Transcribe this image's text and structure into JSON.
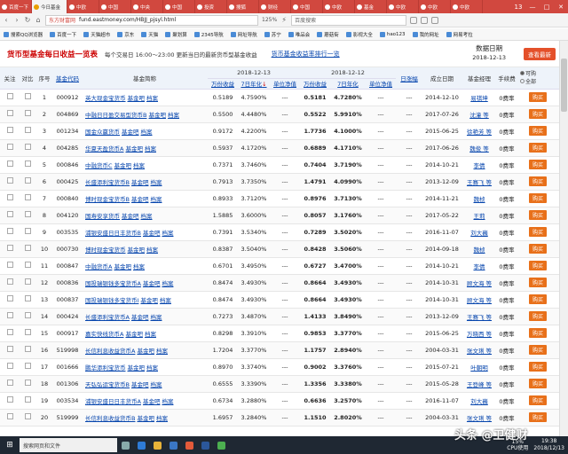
{
  "tabs": [
    {
      "label": "百度一下",
      "active": false
    },
    {
      "label": "今日基金",
      "active": true
    },
    {
      "label": "中欧",
      "active": false
    },
    {
      "label": "中国",
      "active": false
    },
    {
      "label": "中央",
      "active": false
    },
    {
      "label": "中国",
      "active": false
    },
    {
      "label": "投资",
      "active": false
    },
    {
      "label": "搜狐",
      "active": false
    },
    {
      "label": "财经",
      "active": false
    },
    {
      "label": "中国",
      "active": false
    },
    {
      "label": "中欧",
      "active": false
    },
    {
      "label": "基金",
      "active": false
    },
    {
      "label": "中欧",
      "active": false
    },
    {
      "label": "中欧",
      "active": false
    },
    {
      "label": "中欧",
      "active": false
    }
  ],
  "window_controls": {
    "count": "13",
    "min": "—",
    "max": "□",
    "close": "✕"
  },
  "address": {
    "site": "东方财富网",
    "url": "fund.eastmoney.com/HBJJ_pjsyl.html",
    "zoom": "125%",
    "search": "百度搜索"
  },
  "bookmarks": [
    "搜索QQ浏览器",
    "百度一下",
    "天猫超市",
    "京东",
    "天猫",
    "聚划算",
    "2345导航",
    "网址导航",
    "苏宁",
    "唯品会",
    "蘑菇街",
    "影视大全",
    "hao123",
    "我的网址",
    "网易考拉"
  ],
  "header": {
    "title": "货币型基金每日收益一览表",
    "trading_time": "每个交易日 16:00～23:00 更新当日的最新货币型基金收益",
    "link": "货币基金收益率排行一览",
    "date_label": "数据日期",
    "date": "2018-12-13",
    "refresh": "查看最新"
  },
  "columns": {
    "follow": "关注",
    "compare": "对比",
    "seq": "序号",
    "code": "基金代码",
    "name": "基金简称",
    "date1": "2018-12-13",
    "date2": "2018-12-12",
    "wan": "万份收益",
    "nian": "7日年化",
    "nav": "单位净值",
    "daily": "日涨幅",
    "estab": "成立日期",
    "manager": "基金经理",
    "fee": "手续费",
    "opt_buy": "可购",
    "opt_all": "全部"
  },
  "labels": {
    "ba": "基金吧",
    "dang": "档案",
    "buy": "购买"
  },
  "rows": [
    {
      "seq": "1",
      "code": "000912",
      "name": "英大现金宝货币",
      "w1": "0.5189",
      "n1": "4.7590%",
      "u1": "---",
      "w2": "0.5181",
      "n2": "4.7280%",
      "u2": "---",
      "d": "---",
      "estab": "2014-12-10",
      "mgr": "易祺坤",
      "fee": "0费率"
    },
    {
      "seq": "2",
      "code": "004869",
      "name": "中融日日盈交易型货币B",
      "w1": "0.5500",
      "n1": "4.4480%",
      "u1": "---",
      "w2": "0.5522",
      "n2": "5.9910%",
      "u2": "---",
      "d": "---",
      "estab": "2017-07-26",
      "mgr": "沈潼 等",
      "fee": "0费率"
    },
    {
      "seq": "3",
      "code": "001234",
      "name": "国金众赢货币",
      "w1": "0.9172",
      "n1": "4.2200%",
      "u1": "---",
      "w2": "1.7736",
      "n2": "4.1000%",
      "u2": "---",
      "d": "---",
      "estab": "2015-06-25",
      "mgr": "徐艳芳 等",
      "fee": "0费率"
    },
    {
      "seq": "4",
      "code": "004285",
      "name": "华夏天盈货币A",
      "w1": "0.5937",
      "n1": "4.1720%",
      "u1": "---",
      "w2": "0.6889",
      "n2": "4.1710%",
      "u2": "---",
      "d": "---",
      "estab": "2017-06-26",
      "mgr": "魏俊 等",
      "fee": "0费率"
    },
    {
      "seq": "5",
      "code": "000846",
      "name": "中融货币C",
      "w1": "0.7371",
      "n1": "3.7460%",
      "u1": "---",
      "w2": "0.7404",
      "n2": "3.7190%",
      "u2": "---",
      "d": "---",
      "estab": "2014-10-21",
      "mgr": "李倩",
      "fee": "0费率"
    },
    {
      "seq": "6",
      "code": "000425",
      "name": "长盛添利宝货币B",
      "w1": "0.7913",
      "n1": "3.7350%",
      "u1": "---",
      "w2": "1.4791",
      "n2": "4.0990%",
      "u2": "---",
      "d": "---",
      "estab": "2013-12-09",
      "mgr": "王赛飞 等",
      "fee": "0费率"
    },
    {
      "seq": "7",
      "code": "000840",
      "name": "博时现金宝货币B",
      "w1": "0.8933",
      "n1": "3.7120%",
      "u1": "---",
      "w2": "0.8976",
      "n2": "3.7130%",
      "u2": "---",
      "d": "---",
      "estab": "2014-11-21",
      "mgr": "魏桢",
      "fee": "0费率"
    },
    {
      "seq": "8",
      "code": "004120",
      "name": "国寿安享货币",
      "w1": "1.5885",
      "n1": "3.6000%",
      "u1": "---",
      "w2": "0.8057",
      "n2": "3.1760%",
      "u2": "---",
      "d": "---",
      "estab": "2017-05-22",
      "mgr": "王莉",
      "fee": "0费率"
    },
    {
      "seq": "9",
      "code": "003535",
      "name": "浦银安盛日日丰货币B",
      "w1": "0.7391",
      "n1": "3.5340%",
      "u1": "---",
      "w2": "0.7289",
      "n2": "3.5020%",
      "u2": "---",
      "d": "---",
      "estab": "2016-11-07",
      "mgr": "刘大巍",
      "fee": "0费率"
    },
    {
      "seq": "10",
      "code": "000730",
      "name": "博时现金宝货币",
      "w1": "0.8387",
      "n1": "3.5040%",
      "u1": "---",
      "w2": "0.8428",
      "n2": "3.5060%",
      "u2": "---",
      "d": "---",
      "estab": "2014-09-18",
      "mgr": "魏桢",
      "fee": "0费率"
    },
    {
      "seq": "11",
      "code": "000847",
      "name": "中融货币A",
      "w1": "0.6701",
      "n1": "3.4950%",
      "u1": "---",
      "w2": "0.6727",
      "n2": "3.4700%",
      "u2": "---",
      "d": "---",
      "estab": "2014-10-21",
      "mgr": "李倩",
      "fee": "0费率"
    },
    {
      "seq": "12",
      "code": "000836",
      "name": "国投瑞银钱多宝货币A",
      "w1": "0.8474",
      "n1": "3.4930%",
      "u1": "---",
      "w2": "0.8664",
      "n2": "3.4930%",
      "u2": "---",
      "d": "---",
      "estab": "2014-10-31",
      "mgr": "顾文海 等",
      "fee": "0费率"
    },
    {
      "seq": "13",
      "code": "000837",
      "name": "国投瑞银钱多宝货币I",
      "w1": "0.8474",
      "n1": "3.4930%",
      "u1": "---",
      "w2": "0.8664",
      "n2": "3.4930%",
      "u2": "---",
      "d": "---",
      "estab": "2014-10-31",
      "mgr": "顾文海 等",
      "fee": "0费率"
    },
    {
      "seq": "14",
      "code": "000424",
      "name": "长盛添利宝货币A",
      "w1": "0.7273",
      "n1": "3.4870%",
      "u1": "---",
      "w2": "1.4133",
      "n2": "3.8490%",
      "u2": "---",
      "d": "---",
      "estab": "2013-12-09",
      "mgr": "王赛飞 等",
      "fee": "0费率"
    },
    {
      "seq": "15",
      "code": "000917",
      "name": "嘉实快线货币A",
      "w1": "0.8298",
      "n1": "3.3910%",
      "u1": "---",
      "w2": "0.9853",
      "n2": "3.3770%",
      "u2": "---",
      "d": "---",
      "estab": "2015-06-25",
      "mgr": "万晓西 等",
      "fee": "0费率"
    },
    {
      "seq": "16",
      "code": "519998",
      "name": "长信利息收益货币A",
      "w1": "1.7204",
      "n1": "3.3770%",
      "u1": "---",
      "w2": "1.1757",
      "n2": "2.8940%",
      "u2": "---",
      "d": "---",
      "estab": "2004-03-31",
      "mgr": "张文琍 等",
      "fee": "0费率"
    },
    {
      "seq": "17",
      "code": "001666",
      "name": "鹏华添利宝货币",
      "w1": "0.8970",
      "n1": "3.3740%",
      "u1": "---",
      "w2": "0.9002",
      "n2": "3.3760%",
      "u2": "---",
      "d": "---",
      "estab": "2015-07-21",
      "mgr": "叶朝明",
      "fee": "0费率"
    },
    {
      "seq": "18",
      "code": "001306",
      "name": "天弘弘运宝货币B",
      "w1": "0.6555",
      "n1": "3.3390%",
      "u1": "---",
      "w2": "1.3356",
      "n2": "3.3380%",
      "u2": "---",
      "d": "---",
      "estab": "2015-05-28",
      "mgr": "王登峰 等",
      "fee": "0费率"
    },
    {
      "seq": "19",
      "code": "003534",
      "name": "浦银安盛日日丰货币A",
      "w1": "0.6734",
      "n1": "3.2880%",
      "u1": "---",
      "w2": "0.6636",
      "n2": "3.2570%",
      "u2": "---",
      "d": "---",
      "estab": "2016-11-07",
      "mgr": "刘大巍",
      "fee": "0费率"
    },
    {
      "seq": "20",
      "code": "519999",
      "name": "长信利息收益货币B",
      "w1": "1.6957",
      "n1": "3.2840%",
      "u1": "---",
      "w2": "1.1510",
      "n2": "2.8020%",
      "u2": "---",
      "d": "---",
      "estab": "2004-03-31",
      "mgr": "张文琍 等",
      "fee": "0费率"
    }
  ],
  "taskbar": {
    "search": "搜索网页和文件",
    "cpu_pct": "15%",
    "cpu_label": "CPU使用",
    "time": "19:38",
    "date": "2018/12/13"
  },
  "watermark": "头条 @卫健财"
}
